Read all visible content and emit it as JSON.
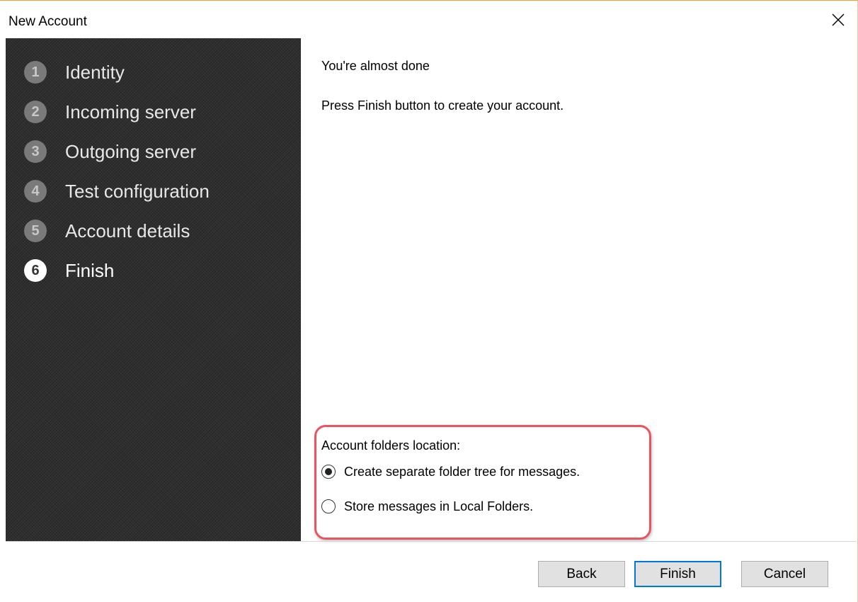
{
  "window": {
    "title": "New Account",
    "close_icon": "close-icon"
  },
  "sidebar": {
    "steps": [
      {
        "number": "1",
        "label": "Identity",
        "active": false
      },
      {
        "number": "2",
        "label": "Incoming server",
        "active": false
      },
      {
        "number": "3",
        "label": "Outgoing server",
        "active": false
      },
      {
        "number": "4",
        "label": "Test configuration",
        "active": false
      },
      {
        "number": "5",
        "label": "Account details",
        "active": false
      },
      {
        "number": "6",
        "label": "Finish",
        "active": true
      }
    ]
  },
  "content": {
    "heading": "You're almost done",
    "instruction": "Press Finish button to create your account.",
    "folders": {
      "label": "Account folders location:",
      "options": [
        {
          "label": "Create separate folder tree for messages.",
          "selected": true
        },
        {
          "label": "Store messages in Local Folders.",
          "selected": false
        }
      ]
    }
  },
  "buttons": {
    "back": "Back",
    "finish": "Finish",
    "cancel": "Cancel"
  },
  "colors": {
    "highlight": "#e85560",
    "primary_button_border": "#0078d7",
    "sidebar_bg": "#2f2f2f"
  }
}
